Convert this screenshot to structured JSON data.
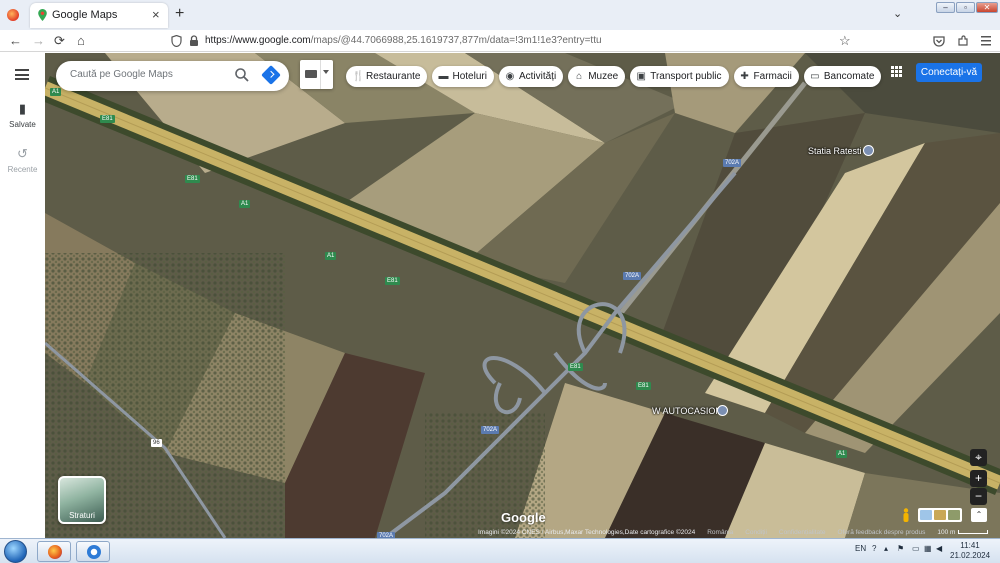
{
  "browser": {
    "tab_title": "Google Maps",
    "tab_close": "×",
    "new_tab": "+",
    "tab_list": "⌄",
    "url_host": "https://www.google.com",
    "url_path": "/maps/@44.7066988,25.1619737,877m/data=!3m1!1e3?entry=ttu",
    "nav": {
      "back": "←",
      "forward": "→",
      "reload": "⟳",
      "home": "⌂",
      "bookmark": "☆"
    },
    "window_controls": {
      "minimize": "–",
      "restore": "▫",
      "close": "✕"
    }
  },
  "maps": {
    "search_placeholder": "Caută pe Google Maps",
    "rail": {
      "saved_label": "Salvate",
      "recent_label": "Recente"
    },
    "chips": [
      {
        "icon": "fork-knife-icon",
        "glyph": "🍴",
        "label": "Restaurante"
      },
      {
        "icon": "bed-icon",
        "glyph": "▬",
        "label": "Hoteluri"
      },
      {
        "icon": "camera-icon",
        "glyph": "◉",
        "label": "Activități"
      },
      {
        "icon": "museum-icon",
        "glyph": "⌂",
        "label": "Muzee"
      },
      {
        "icon": "train-icon",
        "glyph": "▣",
        "label": "Transport public"
      },
      {
        "icon": "pharmacy-icon",
        "glyph": "✚",
        "label": "Farmacii"
      },
      {
        "icon": "atm-icon",
        "glyph": "▭",
        "label": "Bancomate"
      }
    ],
    "sign_in": "Conectați-vă",
    "layers_label": "Straturi",
    "google_logo": "Google",
    "labels": {
      "station": "Statia Ratesti",
      "autocasion": "W AUTOCASION",
      "a1": "A1",
      "e81": "E81",
      "r702a": "702A",
      "r96": "96"
    },
    "attribution": {
      "imagery": "Imagini ©2024 CNES / Airbus,Maxar Technologies,Date cartografice ©2024",
      "country": "România",
      "terms": "Condiții",
      "privacy": "Confidențialitate",
      "feedback": "Oferă feedback despre produs",
      "scale": "100 m"
    },
    "controls": {
      "locate": "⌖",
      "zoom_in": "+",
      "zoom_out": "−",
      "expand": "⌃"
    }
  },
  "taskbar": {
    "language": "EN",
    "time": "11:41",
    "date": "21.02.2024"
  },
  "colors": {
    "accent_blue": "#1a73e8",
    "highway": "#c8b266",
    "road": "#8e97a2"
  }
}
